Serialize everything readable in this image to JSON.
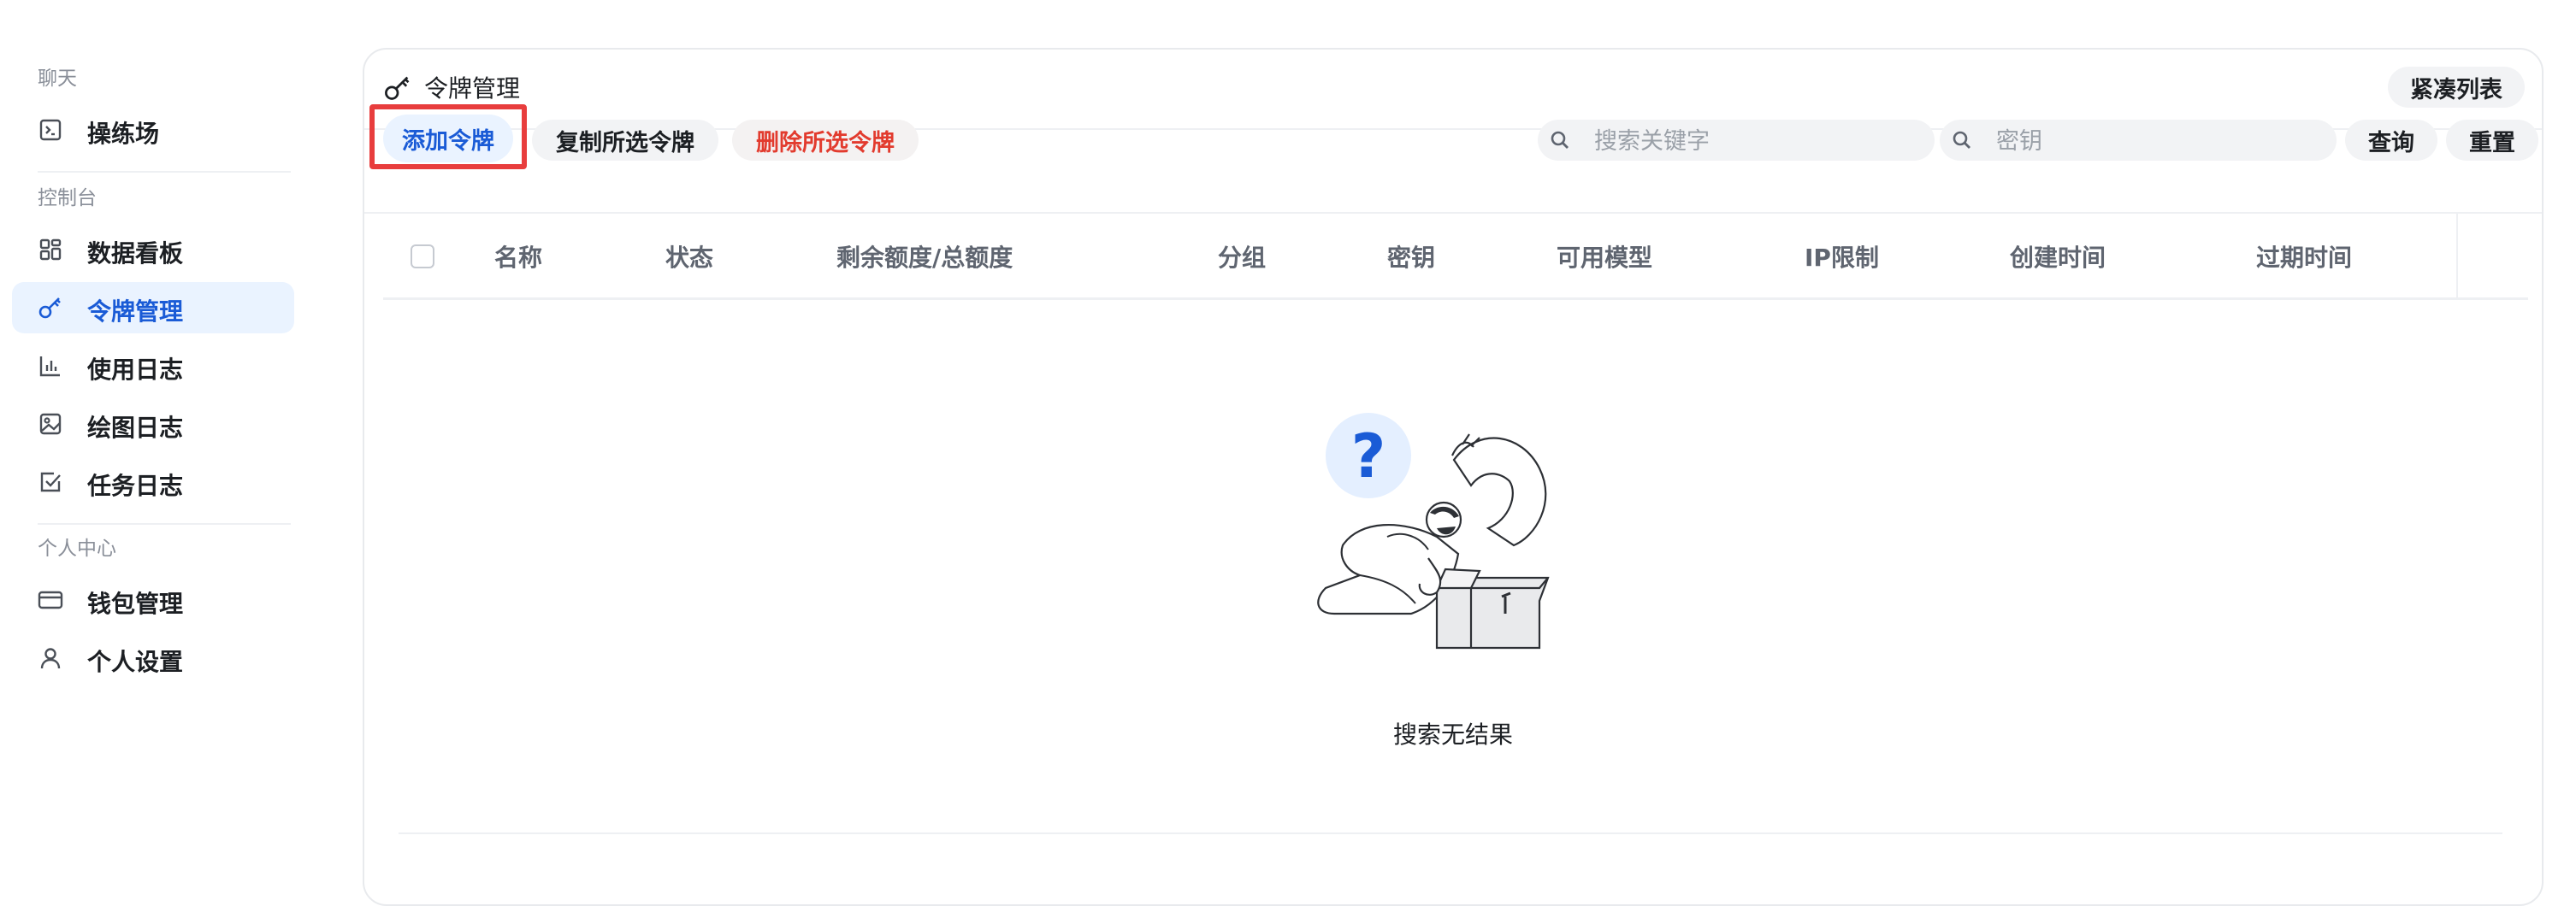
{
  "sidebar": {
    "sections": [
      {
        "title": "聊天"
      },
      {
        "title": "控制台"
      },
      {
        "title": "个人中心"
      }
    ],
    "items": [
      {
        "label": "操练场",
        "icon": "terminal-icon"
      },
      {
        "label": "数据看板",
        "icon": "dashboard-icon"
      },
      {
        "label": "令牌管理",
        "icon": "key-icon",
        "active": true
      },
      {
        "label": "使用日志",
        "icon": "bar-chart-icon"
      },
      {
        "label": "绘图日志",
        "icon": "image-icon"
      },
      {
        "label": "任务日志",
        "icon": "checkbox-icon"
      },
      {
        "label": "钱包管理",
        "icon": "wallet-icon"
      },
      {
        "label": "个人设置",
        "icon": "user-icon"
      }
    ]
  },
  "card": {
    "title": "令牌管理",
    "compact_label": "紧凑列表"
  },
  "toolbar": {
    "add_label": "添加令牌",
    "copy_label": "复制所选令牌",
    "delete_label": "删除所选令牌",
    "keyword_placeholder": "搜索关键字",
    "key_placeholder": "密钥",
    "query_label": "查询",
    "reset_label": "重置"
  },
  "table": {
    "columns": [
      "名称",
      "状态",
      "剩余额度/总额度",
      "分组",
      "密钥",
      "可用模型",
      "IP限制",
      "创建时间",
      "过期时间"
    ],
    "empty_text": "搜索无结果"
  },
  "colors": {
    "accent": "#1a5bd6",
    "active_bg": "#eaf3ff",
    "danger": "#e23b2e",
    "highlight_box": "#e83d3d"
  }
}
